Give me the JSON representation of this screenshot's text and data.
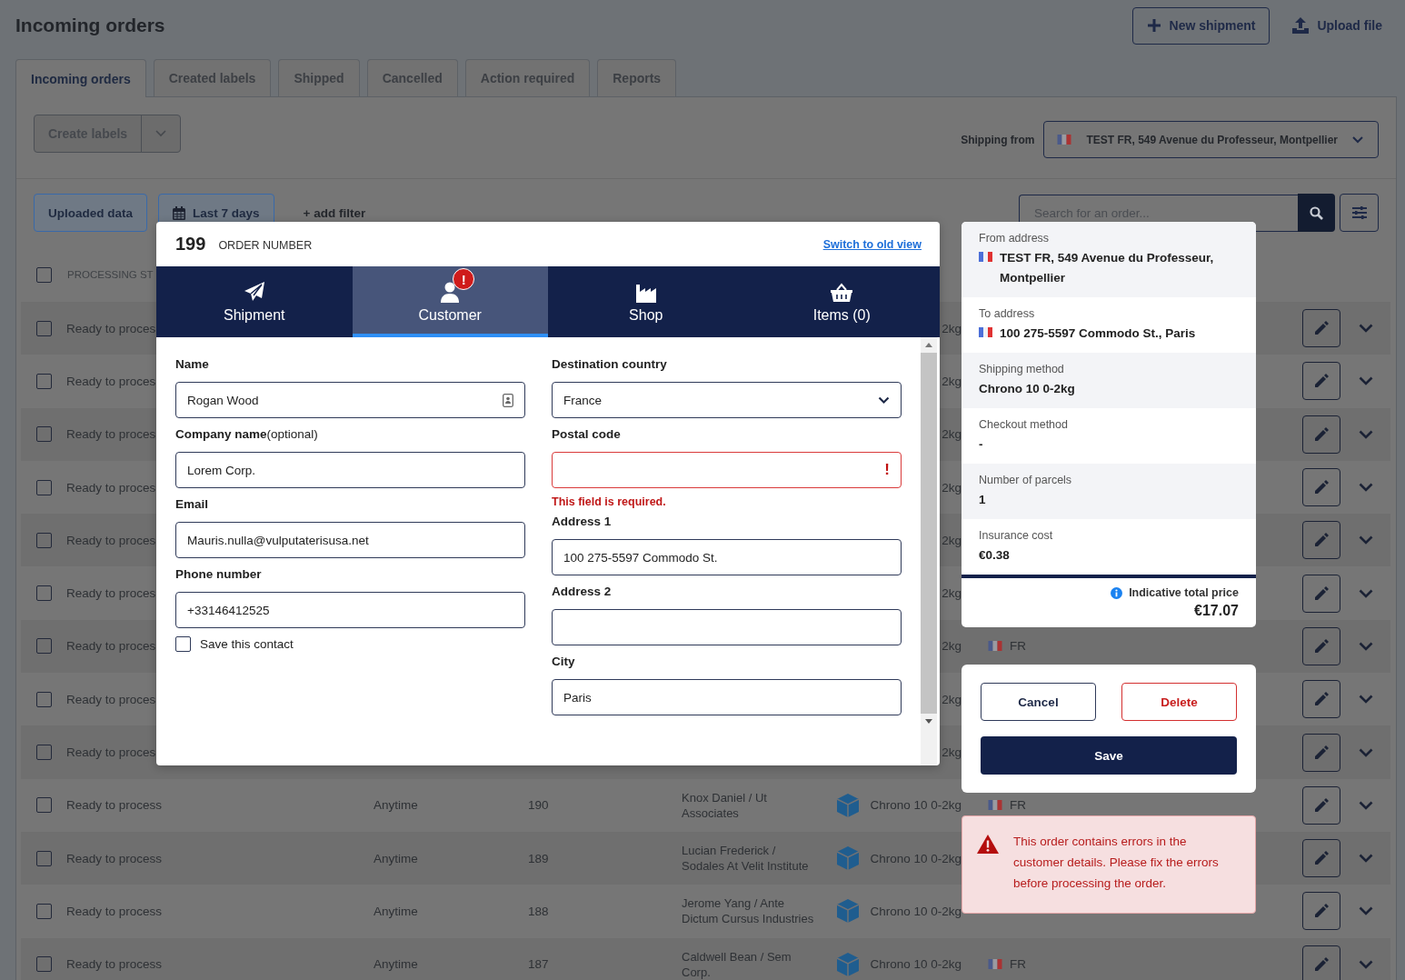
{
  "page_title": "Incoming orders",
  "header_actions": [
    {
      "label": "New shipment",
      "kind": "new"
    },
    {
      "label": "Upload file",
      "kind": "upload"
    }
  ],
  "tabs": [
    {
      "label": "Incoming orders",
      "selected": true
    },
    {
      "label": "Created labels",
      "selected": false
    },
    {
      "label": "Shipped",
      "selected": false
    },
    {
      "label": "Cancelled",
      "selected": false
    },
    {
      "label": "Action required",
      "selected": false
    },
    {
      "label": "Reports",
      "selected": false
    }
  ],
  "toolbar": {
    "create_labels": "Create labels",
    "shipping_from_label": "Shipping from",
    "shipping_from": "TEST FR, 549 Avenue du Professeur, Montpellier"
  },
  "filters": {
    "chips": [
      {
        "label": "Uploaded data",
        "kind": "plain"
      },
      {
        "label": "Last 7 days",
        "kind": "date"
      }
    ],
    "add_filter": "+ add filter",
    "search_placeholder": "Search for an order..."
  },
  "table": {
    "select_all_checked": false,
    "header": "PROCESSING ST",
    "rows": [
      {
        "checked": false,
        "status": "Ready to proces",
        "service": "2kg"
      },
      {
        "checked": false,
        "status": "Ready to proces",
        "service": "2kg"
      },
      {
        "checked": false,
        "status": "Ready to proces",
        "service": "2kg"
      },
      {
        "checked": false,
        "status": "Ready to proces",
        "service": "2kg"
      },
      {
        "checked": false,
        "status": "Ready to proces",
        "service": "2kg"
      },
      {
        "checked": false,
        "status": "Ready to proces",
        "service": "2kg"
      },
      {
        "checked": false,
        "status": "Ready to proces",
        "service": "2kg",
        "country": "FR"
      },
      {
        "checked": false,
        "status": "Ready to proces",
        "service": "2kg"
      },
      {
        "checked": false,
        "status": "Ready to proces",
        "service": "2kg"
      },
      {
        "checked": false,
        "status": "Ready to process",
        "time": "Anytime",
        "number": "190",
        "customer": "Knox Daniel / Ut Associates",
        "service": "Chrono 10 0-2kg",
        "country": "FR"
      },
      {
        "checked": false,
        "status": "Ready to process",
        "time": "Anytime",
        "number": "189",
        "customer": "Lucian Frederick / Sodales At Velit Institute",
        "service": "Chrono 10 0-2kg"
      },
      {
        "checked": false,
        "status": "Ready to process",
        "time": "Anytime",
        "number": "188",
        "customer": "Jerome Yang / Ante Dictum Cursus Industries",
        "service": "Chrono 10 0-2kg"
      },
      {
        "checked": false,
        "status": "Ready to process",
        "time": "Anytime",
        "number": "187",
        "customer": "Caldwell Bean / Sem Corp.",
        "service": "Chrono 10 0-2kg",
        "country": "FR"
      }
    ]
  },
  "order_dialog": {
    "number": "199",
    "number_label": "ORDER NUMBER",
    "switch_link": "Switch to old view",
    "tabs": [
      {
        "label": "Shipment",
        "kind": "shipment",
        "selected": false
      },
      {
        "label": "Customer",
        "kind": "customer",
        "selected": true,
        "alert": "!"
      },
      {
        "label": "Shop",
        "kind": "shop",
        "selected": false
      },
      {
        "label": "Items (0)",
        "kind": "items",
        "selected": false
      }
    ],
    "left_fields": [
      {
        "label": "Name",
        "kind": "contact",
        "value": "Rogan Wood"
      },
      {
        "label": "Company name",
        "note": "(optional)",
        "kind": "text",
        "value": "Lorem Corp."
      },
      {
        "label": "Email",
        "kind": "text",
        "value": "Mauris.nulla@vulputaterisusa.net"
      },
      {
        "label": "Phone number",
        "kind": "text",
        "value": "+33146412525"
      }
    ],
    "save_contact": {
      "label": "Save this contact",
      "checked": false
    },
    "right_fields": [
      {
        "label": "Destination country",
        "kind": "select",
        "value": "France"
      },
      {
        "label": "Postal code",
        "kind": "error",
        "error_mark": "!",
        "error": "This field is required."
      },
      {
        "label": "Address 1",
        "kind": "text",
        "value": "100 275-5597 Commodo St."
      },
      {
        "label": "Address 2",
        "kind": "text"
      },
      {
        "label": "City",
        "kind": "text",
        "value": "Paris"
      }
    ]
  },
  "summary": {
    "rows": [
      {
        "label": "From address",
        "kind": "address",
        "value": "TEST FR, 549 Avenue du Professeur, Montpellier"
      },
      {
        "label": "To address",
        "kind": "address",
        "value": "100 275-5597 Commodo St., Paris"
      },
      {
        "label": "Shipping method",
        "kind": "plain",
        "value": "Chrono 10 0-2kg"
      },
      {
        "label": "Checkout method",
        "kind": "plain",
        "value": "-"
      },
      {
        "label": "Number of parcels",
        "kind": "plain",
        "value": "1"
      },
      {
        "label": "Insurance cost",
        "kind": "plain",
        "value": "€0.38"
      }
    ],
    "total_label": "Indicative total price",
    "total": "€17.07"
  },
  "actions": [
    {
      "label": "Cancel",
      "kind": "secondary"
    },
    {
      "label": "Delete",
      "kind": "danger"
    },
    {
      "label": "Save",
      "kind": "primary"
    }
  ],
  "alert": "This order contains errors in the customer details. Please fix the errors before processing the order."
}
